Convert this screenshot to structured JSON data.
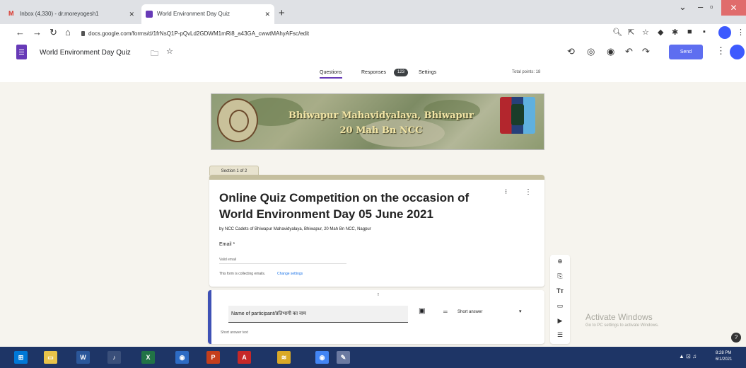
{
  "browser": {
    "tabs": [
      {
        "title": "Inbox (4,330) - dr.moreyogesh1",
        "icon": "gmail-icon"
      },
      {
        "title": "World Environment Day Quiz",
        "icon": "forms-icon"
      }
    ],
    "new_tab": "+",
    "url": "docs.google.com/forms/d/1frNsQ1P-pQvLd2GDWM1mRi8_a43GA_cwwtMAhyAFsc/edit"
  },
  "app": {
    "doc_title": "World Environment Day Quiz",
    "send_label": "Send",
    "accent": "#673ab7"
  },
  "form_tabs": {
    "questions": "Questions",
    "responses": "Responses",
    "responses_count": "123",
    "settings": "Settings",
    "total_points": "Total points: 18"
  },
  "banner": {
    "line1": "Bhiwapur Mahavidyalaya, Bhiwapur",
    "line2": "20 Mah Bn NCC"
  },
  "section_label": "Section 1 of 2",
  "form": {
    "title": "Online Quiz Competition on the occasion of World Environment Day 05 June 2021",
    "description": "by NCC Cadets of Bhiwapur Mahavidyalaya, Bhiwapur, 20 Mah Bn NCC, Nagpur",
    "email_label": "Email *",
    "email_placeholder": "Valid email",
    "collecting_note": "This form is collecting emails.",
    "change_settings": "Change settings"
  },
  "question": {
    "drag": "⠿",
    "label": "Name of participant/प्रतिभागी का नाम",
    "type": "Short answer",
    "answer_placeholder": "Short answer text"
  },
  "watermark": {
    "title": "Activate Windows",
    "subtitle": "Go to PC settings to activate Windows."
  },
  "taskbar": {
    "clock_time": "8:28 PM",
    "clock_date": "6/1/2021"
  }
}
